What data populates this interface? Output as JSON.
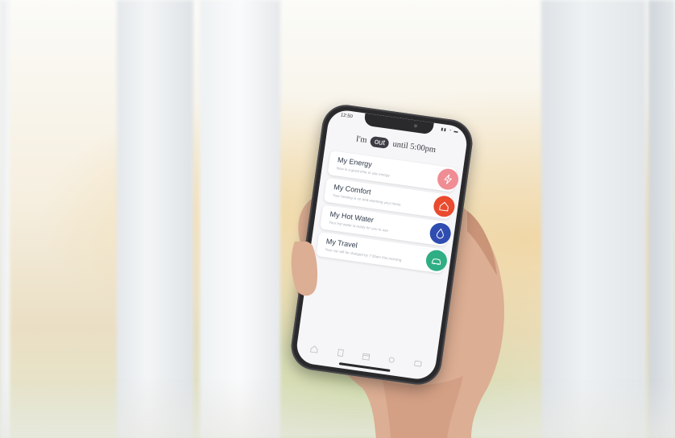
{
  "phone": {
    "status_bar": {
      "time": "12:50"
    },
    "header": {
      "prefix": "I'm",
      "mode": "out",
      "suffix": "until 5:00pm"
    },
    "cards": [
      {
        "title": "My Energy",
        "subtitle": "Now is a good time to use energy",
        "color": "#f08c93",
        "icon": "lightning-icon"
      },
      {
        "title": "My Comfort",
        "subtitle": "Your heating is on and warming your home",
        "color": "#ea4a2e",
        "icon": "house-icon"
      },
      {
        "title": "My Hot Water",
        "subtitle": "Your hot water is ready for you to use",
        "color": "#2f4db0",
        "icon": "water-drop-icon"
      },
      {
        "title": "My Travel",
        "subtitle": "Your car will be charged by 7:30am this morning",
        "color": "#2fae84",
        "icon": "car-icon"
      }
    ],
    "tabs": [
      "home-tab-icon",
      "document-tab-icon",
      "calendar-tab-icon",
      "settings-tab-icon",
      "message-tab-icon"
    ]
  },
  "colors": {
    "phone_body": "#2a2a2d",
    "screen": "#f6f6f8",
    "pill": "#3c3c44"
  }
}
